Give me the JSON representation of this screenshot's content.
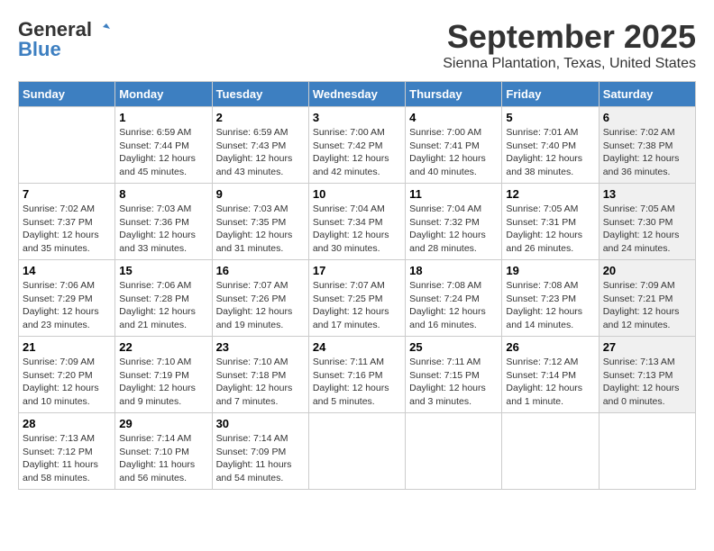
{
  "logo": {
    "general": "General",
    "blue": "Blue"
  },
  "header": {
    "month": "September 2025",
    "location": "Sienna Plantation, Texas, United States"
  },
  "days_of_week": [
    "Sunday",
    "Monday",
    "Tuesday",
    "Wednesday",
    "Thursday",
    "Friday",
    "Saturday"
  ],
  "weeks": [
    [
      {
        "day": "",
        "info": ""
      },
      {
        "day": "1",
        "info": "Sunrise: 6:59 AM\nSunset: 7:44 PM\nDaylight: 12 hours\nand 45 minutes."
      },
      {
        "day": "2",
        "info": "Sunrise: 6:59 AM\nSunset: 7:43 PM\nDaylight: 12 hours\nand 43 minutes."
      },
      {
        "day": "3",
        "info": "Sunrise: 7:00 AM\nSunset: 7:42 PM\nDaylight: 12 hours\nand 42 minutes."
      },
      {
        "day": "4",
        "info": "Sunrise: 7:00 AM\nSunset: 7:41 PM\nDaylight: 12 hours\nand 40 minutes."
      },
      {
        "day": "5",
        "info": "Sunrise: 7:01 AM\nSunset: 7:40 PM\nDaylight: 12 hours\nand 38 minutes."
      },
      {
        "day": "6",
        "info": "Sunrise: 7:02 AM\nSunset: 7:38 PM\nDaylight: 12 hours\nand 36 minutes."
      }
    ],
    [
      {
        "day": "7",
        "info": "Sunrise: 7:02 AM\nSunset: 7:37 PM\nDaylight: 12 hours\nand 35 minutes."
      },
      {
        "day": "8",
        "info": "Sunrise: 7:03 AM\nSunset: 7:36 PM\nDaylight: 12 hours\nand 33 minutes."
      },
      {
        "day": "9",
        "info": "Sunrise: 7:03 AM\nSunset: 7:35 PM\nDaylight: 12 hours\nand 31 minutes."
      },
      {
        "day": "10",
        "info": "Sunrise: 7:04 AM\nSunset: 7:34 PM\nDaylight: 12 hours\nand 30 minutes."
      },
      {
        "day": "11",
        "info": "Sunrise: 7:04 AM\nSunset: 7:32 PM\nDaylight: 12 hours\nand 28 minutes."
      },
      {
        "day": "12",
        "info": "Sunrise: 7:05 AM\nSunset: 7:31 PM\nDaylight: 12 hours\nand 26 minutes."
      },
      {
        "day": "13",
        "info": "Sunrise: 7:05 AM\nSunset: 7:30 PM\nDaylight: 12 hours\nand 24 minutes."
      }
    ],
    [
      {
        "day": "14",
        "info": "Sunrise: 7:06 AM\nSunset: 7:29 PM\nDaylight: 12 hours\nand 23 minutes."
      },
      {
        "day": "15",
        "info": "Sunrise: 7:06 AM\nSunset: 7:28 PM\nDaylight: 12 hours\nand 21 minutes."
      },
      {
        "day": "16",
        "info": "Sunrise: 7:07 AM\nSunset: 7:26 PM\nDaylight: 12 hours\nand 19 minutes."
      },
      {
        "day": "17",
        "info": "Sunrise: 7:07 AM\nSunset: 7:25 PM\nDaylight: 12 hours\nand 17 minutes."
      },
      {
        "day": "18",
        "info": "Sunrise: 7:08 AM\nSunset: 7:24 PM\nDaylight: 12 hours\nand 16 minutes."
      },
      {
        "day": "19",
        "info": "Sunrise: 7:08 AM\nSunset: 7:23 PM\nDaylight: 12 hours\nand 14 minutes."
      },
      {
        "day": "20",
        "info": "Sunrise: 7:09 AM\nSunset: 7:21 PM\nDaylight: 12 hours\nand 12 minutes."
      }
    ],
    [
      {
        "day": "21",
        "info": "Sunrise: 7:09 AM\nSunset: 7:20 PM\nDaylight: 12 hours\nand 10 minutes."
      },
      {
        "day": "22",
        "info": "Sunrise: 7:10 AM\nSunset: 7:19 PM\nDaylight: 12 hours\nand 9 minutes."
      },
      {
        "day": "23",
        "info": "Sunrise: 7:10 AM\nSunset: 7:18 PM\nDaylight: 12 hours\nand 7 minutes."
      },
      {
        "day": "24",
        "info": "Sunrise: 7:11 AM\nSunset: 7:16 PM\nDaylight: 12 hours\nand 5 minutes."
      },
      {
        "day": "25",
        "info": "Sunrise: 7:11 AM\nSunset: 7:15 PM\nDaylight: 12 hours\nand 3 minutes."
      },
      {
        "day": "26",
        "info": "Sunrise: 7:12 AM\nSunset: 7:14 PM\nDaylight: 12 hours\nand 1 minute."
      },
      {
        "day": "27",
        "info": "Sunrise: 7:13 AM\nSunset: 7:13 PM\nDaylight: 12 hours\nand 0 minutes."
      }
    ],
    [
      {
        "day": "28",
        "info": "Sunrise: 7:13 AM\nSunset: 7:12 PM\nDaylight: 11 hours\nand 58 minutes."
      },
      {
        "day": "29",
        "info": "Sunrise: 7:14 AM\nSunset: 7:10 PM\nDaylight: 11 hours\nand 56 minutes."
      },
      {
        "day": "30",
        "info": "Sunrise: 7:14 AM\nSunset: 7:09 PM\nDaylight: 11 hours\nand 54 minutes."
      },
      {
        "day": "",
        "info": ""
      },
      {
        "day": "",
        "info": ""
      },
      {
        "day": "",
        "info": ""
      },
      {
        "day": "",
        "info": ""
      }
    ]
  ]
}
